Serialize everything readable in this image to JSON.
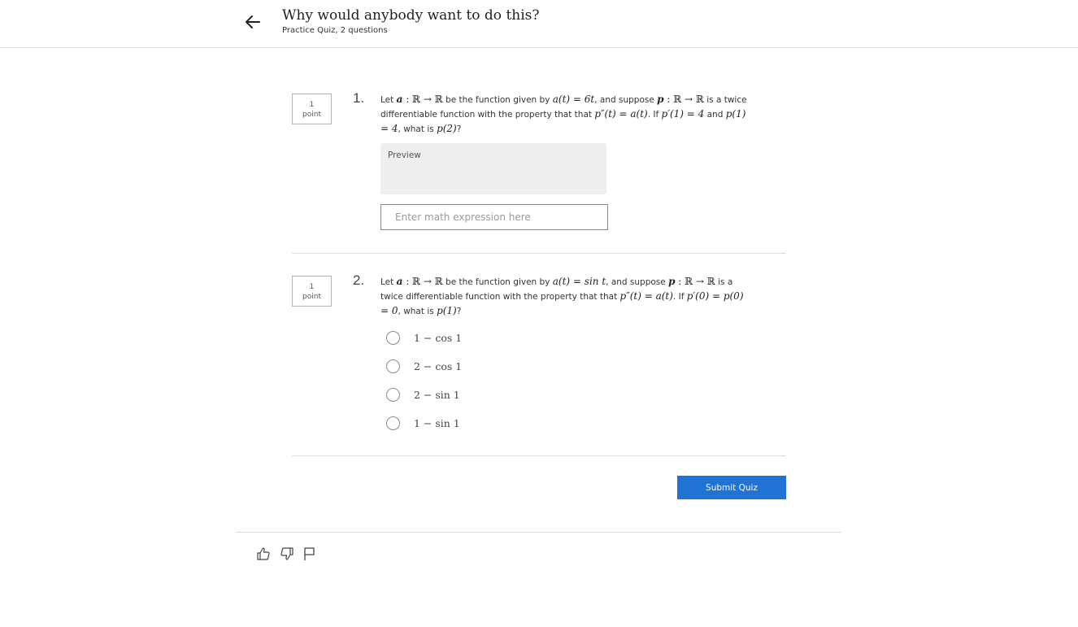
{
  "header": {
    "title": "Why would anybody want to do this?",
    "subtitle": "Practice Quiz, 2 questions"
  },
  "questions": [
    {
      "number": "1.",
      "points": {
        "value": "1",
        "unit": "point"
      },
      "text": {
        "t1": "Let ",
        "m1": "a",
        "m2": " : ℝ → ℝ",
        "t2": " be the function given by ",
        "m3": "a(t) = 6t",
        "t3": ", and suppose ",
        "m4": "p",
        "m5": " : ℝ → ℝ",
        "t4": " is a twice differentiable function with the property that that ",
        "m6": "p″(t) = a(t)",
        "t5": ". If ",
        "m7": "p′(1) = 4",
        "t6": " and ",
        "m8": "p(1) = 4",
        "t7": ", what is ",
        "m9": "p(2)",
        "t8": "?"
      },
      "preview_label": "Preview",
      "input_placeholder": "Enter math expression here",
      "input_value": ""
    },
    {
      "number": "2.",
      "points": {
        "value": "1",
        "unit": "point"
      },
      "text": {
        "t1": "Let ",
        "m1": "a",
        "m2": " : ℝ → ℝ",
        "t2": " be the function given by ",
        "m3": "a(t) = sin t",
        "t3": ", and suppose ",
        "m4": "p",
        "m5": " : ℝ → ℝ",
        "t4": " is a twice differentiable function with the property that that ",
        "m6": "p″(t) = a(t)",
        "t5": ". If ",
        "m7": "p′(0) = p(0) = 0",
        "t6": ", what is ",
        "m8": "p(1)",
        "t7": "?"
      },
      "options": [
        "1 − cos 1",
        "2 − cos 1",
        "2 − sin 1",
        "1 − sin 1"
      ],
      "selected_option": null
    }
  ],
  "actions": {
    "submit_label": "Submit Quiz"
  },
  "footer": {
    "icons": [
      "thumbs-up-icon",
      "thumbs-down-icon",
      "flag-icon"
    ]
  },
  "colors": {
    "accent": "#2073d5",
    "divider": "#dcdcdc",
    "preview_bg": "#eeeeee"
  }
}
